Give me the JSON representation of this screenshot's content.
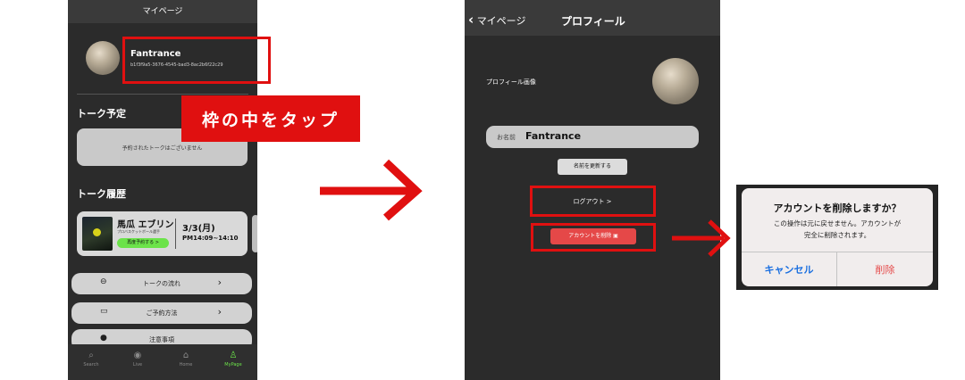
{
  "colors": {
    "red": "#e01010",
    "dark_bg": "#2b2b2b",
    "green_button": "#6ce34a",
    "ios_blue": "#1a6fe0",
    "delete_red": "#e54848"
  },
  "phone1": {
    "header_title": "マイページ",
    "profile_name": "Fantrance",
    "profile_id": "b1f3f9a5-3676-4545-bad3-8ac2b6f22c29",
    "talk_schedule_title": "トーク予定",
    "talk_schedule_empty": "予約されたトークはございません",
    "talk_history_title": "トーク履歴",
    "history_card": {
      "name": "馬瓜 エブリン",
      "subtitle": "プロバスケットボール選手",
      "rebook_button": "再度予約する >",
      "date": "3/3(月)",
      "time": "PM14:09~14:10"
    },
    "menu": [
      {
        "icon": "chat-icon",
        "label": "トークの流れ"
      },
      {
        "icon": "video-icon",
        "label": "ご予約方法"
      },
      {
        "icon": "alert-icon",
        "label": "注意事項"
      }
    ],
    "tabs": [
      {
        "icon": "search-icon",
        "label": "Search"
      },
      {
        "icon": "play-icon",
        "label": "Live"
      },
      {
        "icon": "home-icon",
        "label": "Home"
      },
      {
        "icon": "person-icon",
        "label": "MyPage"
      }
    ]
  },
  "callout_text": "枠の中をタップ",
  "phone2": {
    "back_label": "マイページ",
    "title": "プロフィール",
    "profile_image_label": "プロフィール画像",
    "name_field_label": "お名前",
    "name_field_value": "Fantrance",
    "update_name_button": "名前を更新する",
    "logout_button": "ログアウト >",
    "delete_account_button": "アカウントを削除"
  },
  "dialog": {
    "title": "アカウントを削除しますか？",
    "message_line1": "この操作は元に戻せません。アカウントが",
    "message_line2": "完全に削除されます。",
    "cancel": "キャンセル",
    "delete": "削除"
  }
}
